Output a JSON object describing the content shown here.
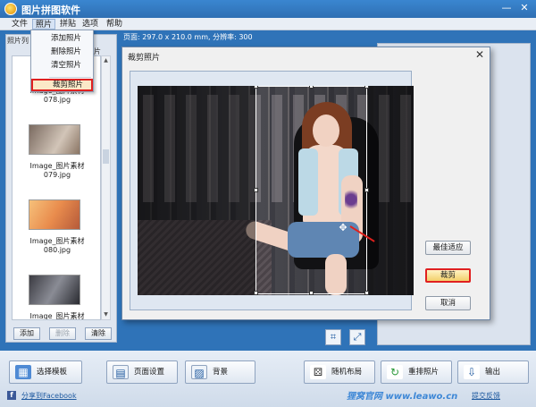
{
  "app": {
    "title": "图片拼图软件"
  },
  "window_controls": {
    "minimize": "—",
    "close": "✕"
  },
  "menubar": {
    "items": [
      "文件",
      "照片",
      "拼贴",
      "选项",
      "帮助"
    ]
  },
  "status": {
    "page_info": "页面: 297.0 x 210.0 mm, 分辨率: 300"
  },
  "left_panel": {
    "tab_label": "照片列",
    "tab_label2": "片",
    "photos": [
      {
        "label_line1": "Image_图片素材",
        "label_line2": "078.jpg"
      },
      {
        "label_line1": "Image_图片素材",
        "label_line2": "079.jpg"
      },
      {
        "label_line1": "Image_图片素材",
        "label_line2": "080.jpg"
      },
      {
        "label_line1": "Image_图片素材",
        "label_line2": ""
      }
    ],
    "buttons": {
      "add": "添加",
      "delete": "删除",
      "clear": "清除"
    }
  },
  "dropdown": {
    "items": [
      "添加照片",
      "删除照片",
      "清空照片",
      "裁剪照片"
    ]
  },
  "dialog": {
    "title": "裁剪照片",
    "close": "✕",
    "buttons": {
      "best_fit": "最佳适应",
      "crop": "裁剪",
      "cancel": "取消"
    }
  },
  "bottom_toolbar": {
    "buttons": [
      "选择模板",
      "页面设置",
      "背景",
      "随机布局",
      "重排照片",
      "输出"
    ]
  },
  "footer": {
    "share": "分享到Facebook",
    "watermark": "狸窝官网 www.leawo.cn",
    "feedback": "提交反馈"
  },
  "colors": {
    "highlight_border": "#e02020",
    "accent_blue": "#2f73b8"
  }
}
